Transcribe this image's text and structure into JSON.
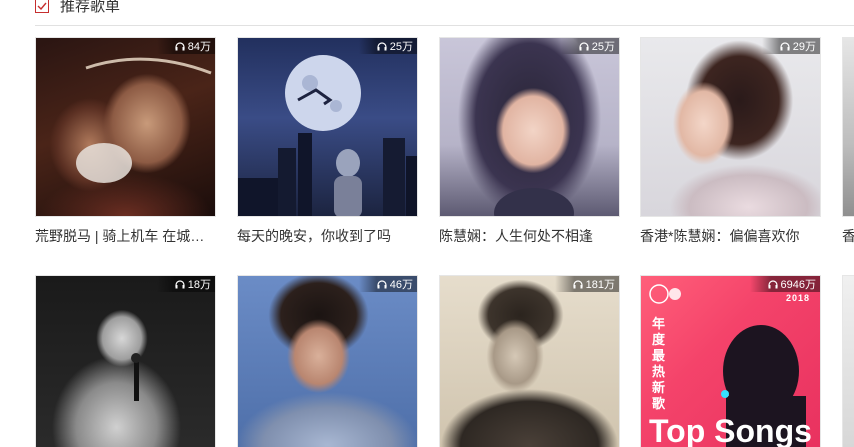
{
  "section": {
    "title": "推荐歌单"
  },
  "playlists": [
    {
      "title": "荒野脱马 | 骑上机车 在城市夜晚狂奔",
      "play_count": "84万"
    },
    {
      "title": "每天的晚安，你收到了吗",
      "play_count": "25万"
    },
    {
      "title": "陈慧娴：人生何处不相逢",
      "play_count": "25万"
    },
    {
      "title": "香港*陈慧娴：偏偏喜欢你",
      "play_count": "29万"
    },
    {
      "title": "香",
      "play_count": ""
    },
    {
      "title": "",
      "play_count": "18万"
    },
    {
      "title": "",
      "play_count": "46万"
    },
    {
      "title": "",
      "play_count": "181万"
    },
    {
      "title": "",
      "play_count": "6946万",
      "cover_text": {
        "vertical": "年度最热新歌",
        "year": "2018",
        "bottom": "Top Songs"
      }
    },
    {
      "title": "",
      "play_count": ""
    }
  ],
  "colors": {
    "accent": "#c62f2f"
  },
  "icons": {
    "check": "check-icon",
    "headphones": "headphones-icon"
  }
}
